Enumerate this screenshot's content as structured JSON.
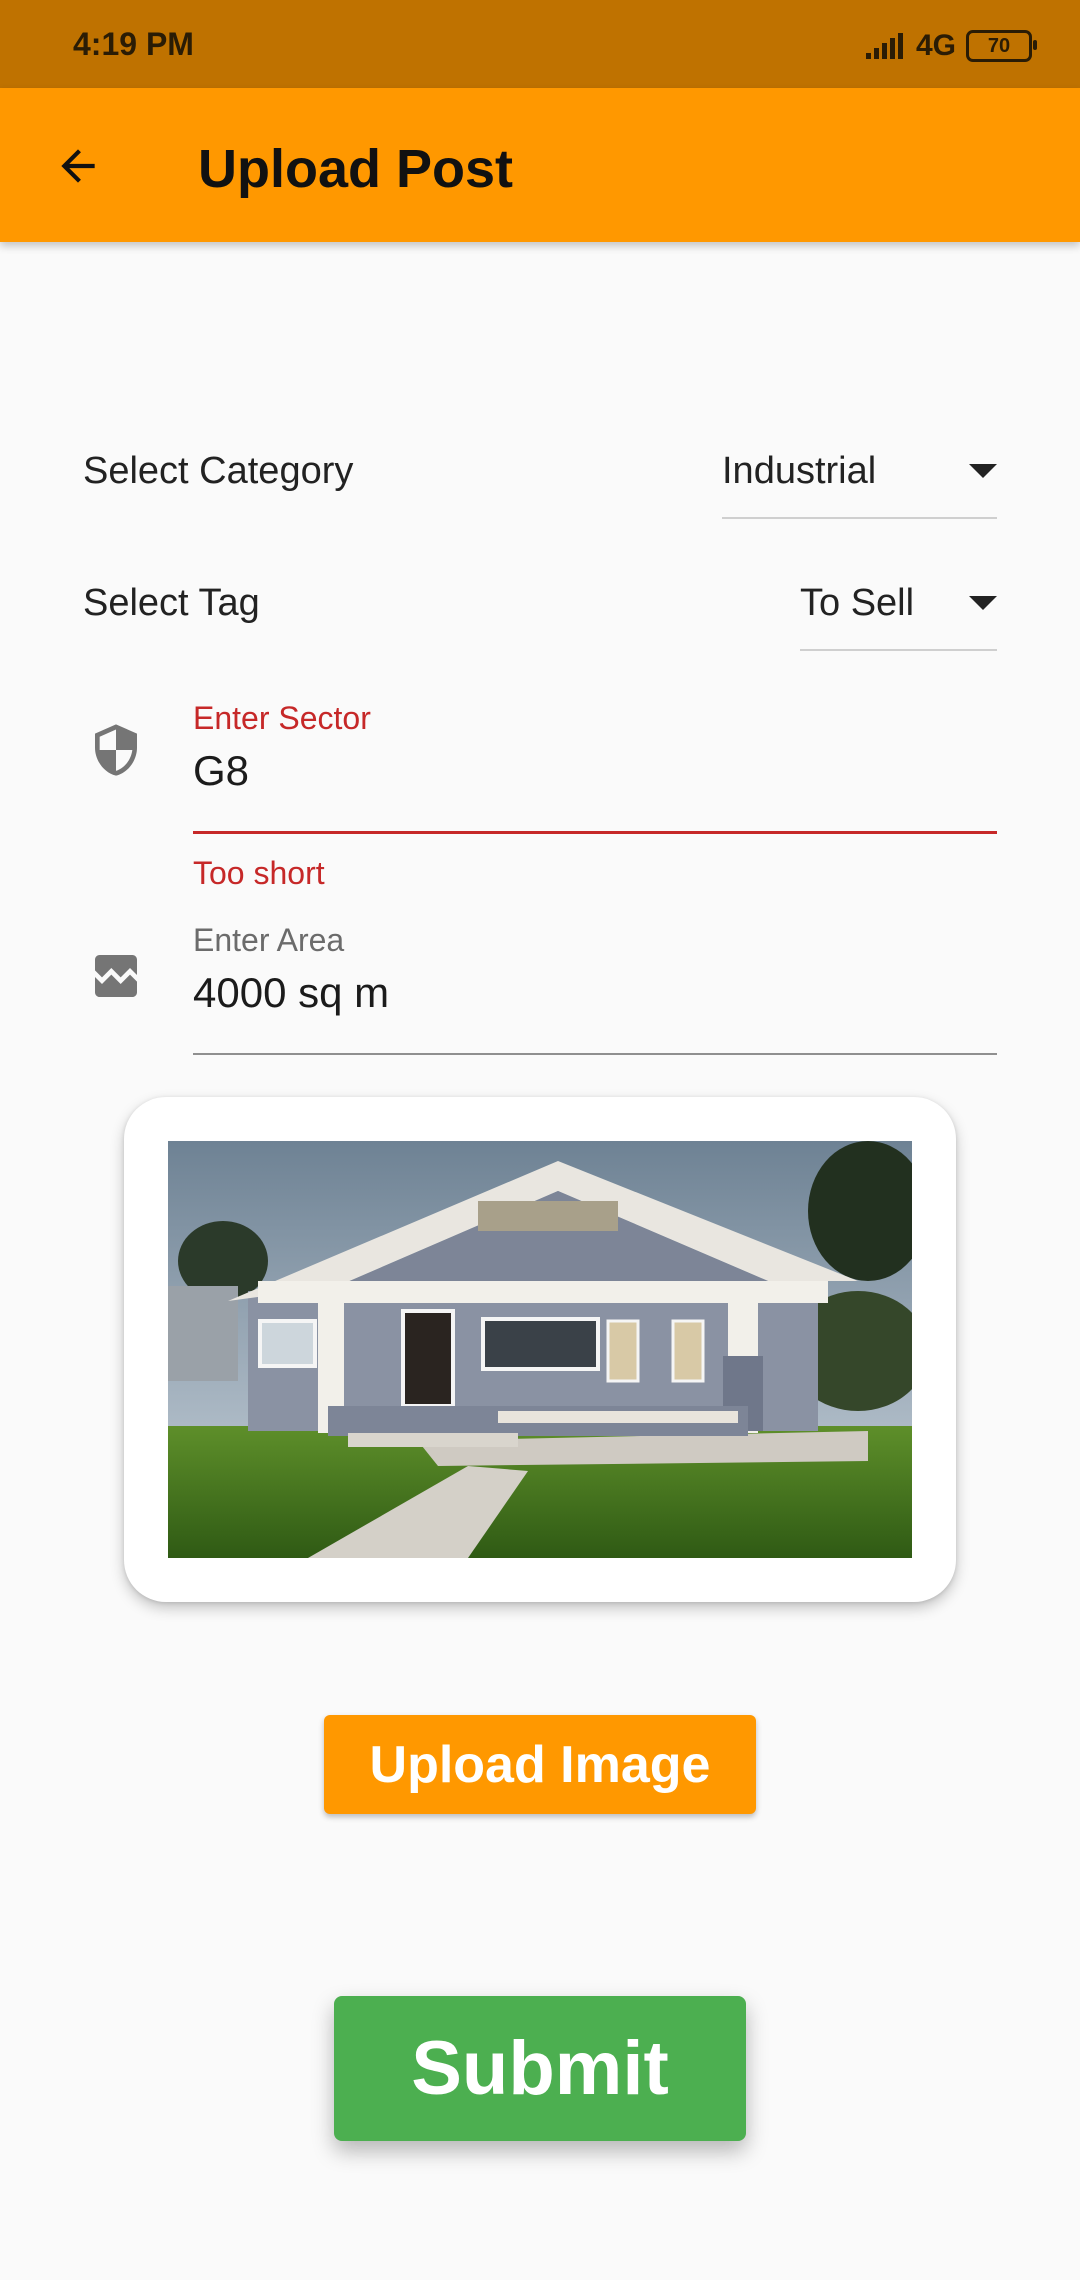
{
  "status_bar": {
    "time": "4:19 PM",
    "network": "4G",
    "battery": "70"
  },
  "app_bar": {
    "title": "Upload Post",
    "back_icon": "arrow-left-icon"
  },
  "form": {
    "category": {
      "label": "Select Category",
      "value": "Industrial"
    },
    "tag": {
      "label": "Select Tag",
      "value": "To Sell"
    },
    "sector": {
      "label": "Enter Sector",
      "value": "G8",
      "error": "Too short",
      "icon": "shield-icon"
    },
    "area": {
      "label": "Enter Area",
      "value": "4000 sq m",
      "icon": "landscape-icon"
    }
  },
  "colors": {
    "primary": "#ff9800",
    "status_bar": "#bf7200",
    "error": "#c62828",
    "submit": "#4caf50"
  },
  "buttons": {
    "upload_label": "Upload Image",
    "submit_label": "Submit"
  }
}
